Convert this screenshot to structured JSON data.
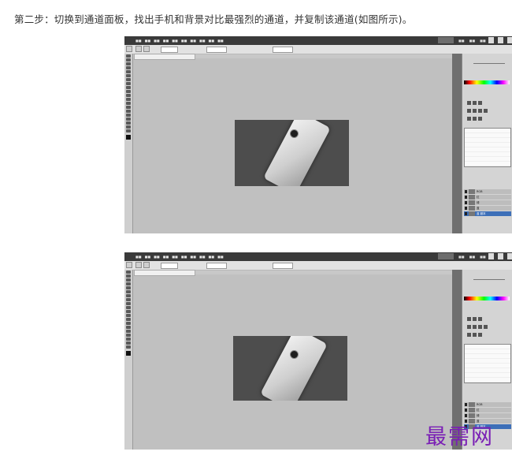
{
  "intro_text": "第二步：切换到通道面板，找出手机和背景对比最强烈的通道，并复制该通道(如图所示)。",
  "watermark_text": "最需网",
  "colors": {
    "accent": "#7a1fb5",
    "channel_selected": "#3d6fb8",
    "app_chrome": "#3a3a3a"
  },
  "screenshots": [
    {
      "label": "screenshot-1",
      "photo": {
        "bg": "#4d4d4d"
      },
      "channels": [
        "RGB",
        "红",
        "绿",
        "蓝",
        "蓝 副本"
      ]
    },
    {
      "label": "screenshot-2",
      "photo": {
        "bg": "#4a4a4a"
      },
      "channels": [
        "RGB",
        "红",
        "绿",
        "蓝",
        "蓝 副本"
      ]
    }
  ]
}
